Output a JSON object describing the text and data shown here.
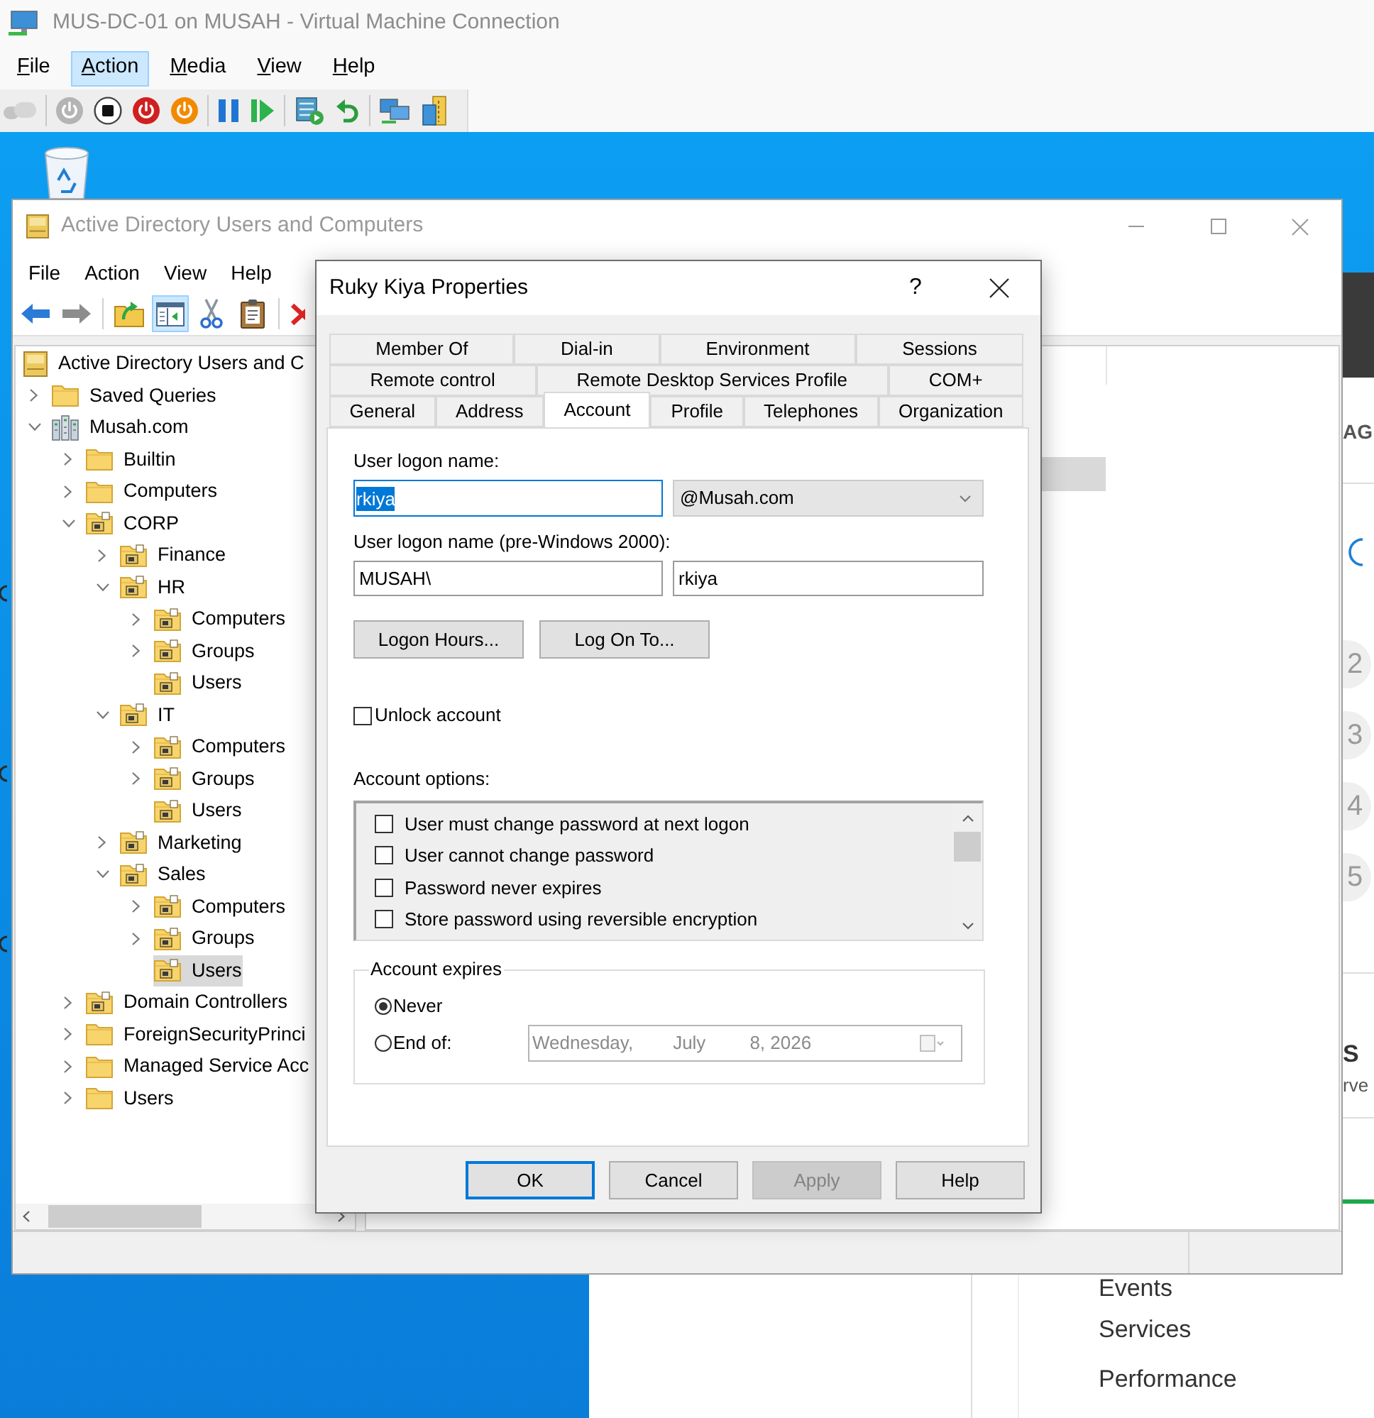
{
  "vm_window": {
    "title": "MUS-DC-01 on MUSAH - Virtual Machine Connection",
    "menu": [
      {
        "label": "File",
        "selected": false
      },
      {
        "label": "Action",
        "selected": true
      },
      {
        "label": "Media",
        "selected": false
      },
      {
        "label": "View",
        "selected": false
      },
      {
        "label": "Help",
        "selected": false
      }
    ],
    "toolbar_groups": [
      [
        {
          "kind": "ctrl-alt-del",
          "disabled": true
        }
      ],
      [
        {
          "kind": "start",
          "disabled": true
        },
        {
          "kind": "turn-off",
          "disabled": false
        },
        {
          "kind": "shut-down",
          "disabled": false
        },
        {
          "kind": "save",
          "disabled": false
        }
      ],
      [
        {
          "kind": "pause",
          "disabled": false
        },
        {
          "kind": "resume",
          "disabled": false
        }
      ],
      [
        {
          "kind": "checkpoint",
          "disabled": false
        },
        {
          "kind": "revert",
          "disabled": false
        }
      ],
      [
        {
          "kind": "enhanced-session",
          "disabled": false
        },
        {
          "kind": "share",
          "disabled": false
        }
      ]
    ]
  },
  "server_manager": {
    "heading_fragment": "AG",
    "steps": [
      "2",
      "3",
      "4",
      "5"
    ],
    "tile_title_fragment": "S",
    "tile_subtitle_fragment": "rve",
    "links": [
      "Events",
      "Services",
      "Performance"
    ]
  },
  "ad_window": {
    "title": "Active Directory Users and Computers",
    "menu": [
      "File",
      "Action",
      "View",
      "Help"
    ],
    "toolbar_groups": [
      [
        {
          "kind": "back",
          "disabled": false,
          "pressed": false
        },
        {
          "kind": "forward",
          "disabled": true,
          "pressed": false
        }
      ],
      [
        {
          "kind": "up-folder",
          "disabled": false,
          "pressed": false
        },
        {
          "kind": "console-tree",
          "disabled": false,
          "pressed": true
        },
        {
          "kind": "cut",
          "disabled": false,
          "pressed": false
        },
        {
          "kind": "paste",
          "disabled": false,
          "pressed": false
        }
      ],
      [
        {
          "kind": "delete",
          "disabled": false,
          "pressed": false
        }
      ]
    ],
    "tree": [
      {
        "label": "Active Directory Users and C",
        "kind": "root",
        "selected": false,
        "children": [
          {
            "label": "Saved Queries",
            "kind": "container",
            "expanded": false,
            "selected": false
          },
          {
            "label": "Musah.com",
            "kind": "domain",
            "expanded": true,
            "selected": false,
            "children": [
              {
                "label": "Builtin",
                "kind": "container",
                "expanded": false,
                "selected": false
              },
              {
                "label": "Computers",
                "kind": "container",
                "expanded": false,
                "selected": false
              },
              {
                "label": "CORP",
                "kind": "ou",
                "expanded": true,
                "selected": false,
                "children": [
                  {
                    "label": "Finance",
                    "kind": "ou",
                    "expanded": false,
                    "selected": false
                  },
                  {
                    "label": "HR",
                    "kind": "ou",
                    "expanded": true,
                    "selected": false,
                    "children": [
                      {
                        "label": "Computers",
                        "kind": "ou",
                        "expanded": false,
                        "selected": false
                      },
                      {
                        "label": "Groups",
                        "kind": "ou",
                        "expanded": false,
                        "selected": false
                      },
                      {
                        "label": "Users",
                        "kind": "ou",
                        "selected": false
                      }
                    ]
                  },
                  {
                    "label": "IT",
                    "kind": "ou",
                    "expanded": true,
                    "selected": false,
                    "children": [
                      {
                        "label": "Computers",
                        "kind": "ou",
                        "expanded": false,
                        "selected": false
                      },
                      {
                        "label": "Groups",
                        "kind": "ou",
                        "expanded": false,
                        "selected": false
                      },
                      {
                        "label": "Users",
                        "kind": "ou",
                        "selected": false
                      }
                    ]
                  },
                  {
                    "label": "Marketing",
                    "kind": "ou",
                    "expanded": false,
                    "selected": false
                  },
                  {
                    "label": "Sales",
                    "kind": "ou",
                    "expanded": true,
                    "selected": false,
                    "children": [
                      {
                        "label": "Computers",
                        "kind": "ou",
                        "expanded": false,
                        "selected": false
                      },
                      {
                        "label": "Groups",
                        "kind": "ou",
                        "expanded": false,
                        "selected": false
                      },
                      {
                        "label": "Users",
                        "kind": "ou",
                        "selected": true
                      }
                    ]
                  }
                ]
              },
              {
                "label": "Domain Controllers",
                "kind": "ou",
                "expanded": false,
                "selected": false
              },
              {
                "label": "ForeignSecurityPrinci",
                "kind": "container",
                "expanded": false,
                "selected": false
              },
              {
                "label": "Managed Service Acc",
                "kind": "container",
                "expanded": false,
                "selected": false
              },
              {
                "label": "Users",
                "kind": "container",
                "expanded": false,
                "selected": false
              }
            ]
          }
        ]
      }
    ]
  },
  "dialog": {
    "title": "Ruky Kiya Properties",
    "help_glyph": "?",
    "tab_rows": [
      [
        {
          "label": "Member Of",
          "selected": false
        },
        {
          "label": "Dial-in",
          "selected": false
        },
        {
          "label": "Environment",
          "selected": false
        },
        {
          "label": "Sessions",
          "selected": false
        }
      ],
      [
        {
          "label": "Remote control",
          "selected": false
        },
        {
          "label": "Remote Desktop Services Profile",
          "selected": false
        },
        {
          "label": "COM+",
          "selected": false
        }
      ],
      [
        {
          "label": "General",
          "selected": false
        },
        {
          "label": "Address",
          "selected": false
        },
        {
          "label": "Account",
          "selected": true
        },
        {
          "label": "Profile",
          "selected": false
        },
        {
          "label": "Telephones",
          "selected": false
        },
        {
          "label": "Organization",
          "selected": false
        }
      ]
    ],
    "logon_name": {
      "label": "User logon name:",
      "value": "rkiya",
      "focused": true,
      "text_selected": true,
      "suffix": "@Musah.com"
    },
    "pre_windows_2000": {
      "label": "User logon name (pre-Windows 2000):",
      "domain": "MUSAH\\",
      "value": "rkiya"
    },
    "action_buttons": [
      "Logon Hours...",
      "Log On To..."
    ],
    "unlock": {
      "label": "Unlock account",
      "checked": false
    },
    "account_options": {
      "label": "Account options:",
      "items": [
        {
          "label": "User must change password at next logon",
          "checked": false
        },
        {
          "label": "User cannot change password",
          "checked": false
        },
        {
          "label": "Password never expires",
          "checked": false
        },
        {
          "label": "Store password using reversible encryption",
          "checked": false
        }
      ]
    },
    "account_expires": {
      "label": "Account expires",
      "options": [
        {
          "label": "Never",
          "selected": true
        },
        {
          "label": "End of:",
          "selected": false
        }
      ],
      "date": {
        "weekday": "Wednesday,",
        "month": "July",
        "day_year": "8, 2026",
        "disabled": true
      }
    },
    "buttons": [
      {
        "label": "OK",
        "default": true,
        "disabled": false
      },
      {
        "label": "Cancel",
        "default": false,
        "disabled": false
      },
      {
        "label": "Apply",
        "default": false,
        "disabled": true
      },
      {
        "label": "Help",
        "default": false,
        "disabled": false
      }
    ]
  }
}
